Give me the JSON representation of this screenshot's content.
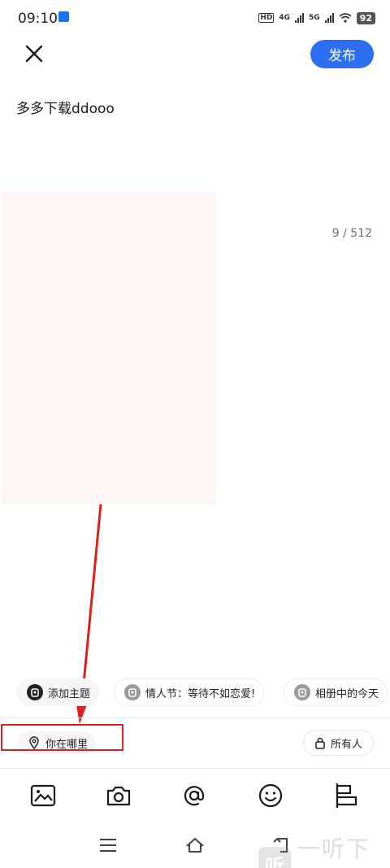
{
  "status_bar": {
    "time": "09:10",
    "hd": "HD",
    "net1": "4G",
    "net2": "5G",
    "battery": "92"
  },
  "header": {
    "close_icon": "close-icon",
    "publish_label": "发布"
  },
  "post": {
    "text": "多多下载ddooo",
    "char_count": "9 / 512"
  },
  "chips": [
    {
      "label": "添加主题",
      "icon": "topic-icon"
    },
    {
      "label": "情人节：等待不如恋爱!",
      "icon": "topic-icon"
    },
    {
      "label": "相册中的今天",
      "icon": "topic-icon"
    }
  ],
  "location": {
    "label": "你在哪里",
    "icon": "location-pin-icon"
  },
  "audience": {
    "label": "所有人",
    "icon": "lock-icon"
  },
  "toolbar": {
    "items": [
      "image-icon",
      "camera-icon",
      "at-icon",
      "emoji-icon",
      "layout-icon"
    ]
  },
  "watermark": {
    "logo_text": "听",
    "text": "一听下载"
  },
  "colors": {
    "accent": "#2c6ff2",
    "annotation": "#e02020"
  }
}
